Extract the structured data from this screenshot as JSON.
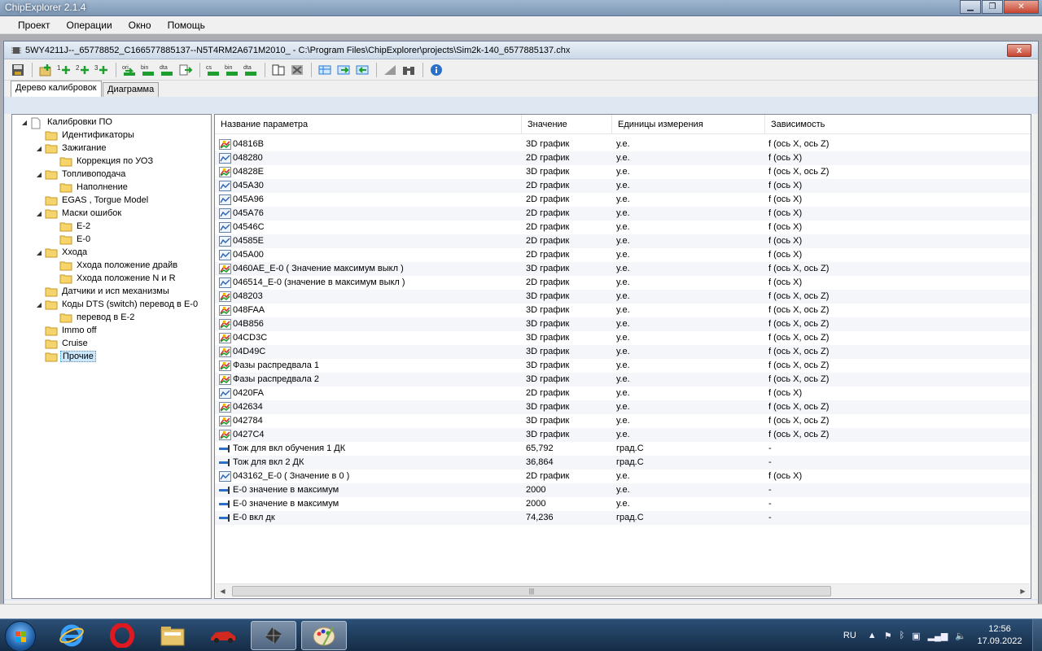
{
  "app": {
    "title": "ChipExplorer 2.1.4"
  },
  "menu": {
    "items": [
      "Проект",
      "Операции",
      "Окно",
      "Помощь"
    ]
  },
  "document": {
    "title": "5WY4211J--_65778852_C166577885137--N5T4RM2A671M2010_ - C:\\Program Files\\ChipExplorer\\projects\\Sim2k-140_6577885137.chx",
    "close_label": "x"
  },
  "toolbar": {
    "icons": [
      "save-icon",
      "add-folder-icon",
      "add-1d-icon",
      "add-2d-icon",
      "add-3d-icon",
      "import-ori-icon",
      "import-bin-icon",
      "import-dta-icon",
      "export-icon",
      "compare-1-icon",
      "compare-2-icon",
      "compare-3-icon",
      "copy-icon",
      "delete-icon",
      "table-icon",
      "table-export-icon",
      "table-import-icon",
      "triangle-icon",
      "binoculars-icon",
      "info-icon"
    ]
  },
  "tabs": [
    {
      "label": "Дерево калибровок",
      "active": true
    },
    {
      "label": "Диаграмма",
      "active": false
    }
  ],
  "tree": {
    "root": "Калибровки ПО",
    "items": [
      {
        "label": "Идентификаторы",
        "level": 1,
        "toggle": ""
      },
      {
        "label": "Зажигание",
        "level": 1,
        "toggle": "◢"
      },
      {
        "label": "Коррекция по УОЗ",
        "level": 2,
        "toggle": ""
      },
      {
        "label": "Топливоподача",
        "level": 1,
        "toggle": "◢"
      },
      {
        "label": "Наполнение",
        "level": 2,
        "toggle": ""
      },
      {
        "label": "EGAS , Torgue Model",
        "level": 1,
        "toggle": ""
      },
      {
        "label": "Маски ошибок",
        "level": 1,
        "toggle": "◢"
      },
      {
        "label": "E-2",
        "level": 2,
        "toggle": ""
      },
      {
        "label": "E-0",
        "level": 2,
        "toggle": ""
      },
      {
        "label": "Ххода",
        "level": 1,
        "toggle": "◢"
      },
      {
        "label": "Ххода положение драйв",
        "level": 2,
        "toggle": ""
      },
      {
        "label": "Ххода положение N и R",
        "level": 2,
        "toggle": ""
      },
      {
        "label": "Датчики и исп механизмы",
        "level": 1,
        "toggle": ""
      },
      {
        "label": "Коды DTS (switch) перевод в E-0",
        "level": 1,
        "toggle": "◢"
      },
      {
        "label": "перевод в E-2",
        "level": 2,
        "toggle": ""
      },
      {
        "label": "Immo off",
        "level": 1,
        "toggle": ""
      },
      {
        "label": "Cruise",
        "level": 1,
        "toggle": ""
      },
      {
        "label": "Прочие",
        "level": 1,
        "toggle": "",
        "selected": true
      }
    ]
  },
  "grid": {
    "columns": [
      "Название параметра",
      "Значение",
      "Единицы измерения",
      "Зависимость"
    ],
    "rows": [
      {
        "icon": "3d",
        "name": "04816B",
        "value": "3D график",
        "unit": "у.е.",
        "dep": "f (ось X, ось Z)"
      },
      {
        "icon": "2d",
        "name": "048280",
        "value": "2D график",
        "unit": "у.е.",
        "dep": "f (ось X)"
      },
      {
        "icon": "3d",
        "name": "04828E",
        "value": "3D график",
        "unit": "у.е.",
        "dep": "f (ось X, ось Z)"
      },
      {
        "icon": "2d",
        "name": "045A30",
        "value": "2D график",
        "unit": "у.е.",
        "dep": "f (ось X)"
      },
      {
        "icon": "2d",
        "name": "045A96",
        "value": "2D график",
        "unit": "у.е.",
        "dep": "f (ось X)"
      },
      {
        "icon": "2d",
        "name": "045A76",
        "value": "2D график",
        "unit": "у.е.",
        "dep": "f (ось X)"
      },
      {
        "icon": "2d",
        "name": "04546C",
        "value": "2D график",
        "unit": "у.е.",
        "dep": "f (ось X)"
      },
      {
        "icon": "2d",
        "name": "04585E",
        "value": "2D график",
        "unit": "у.е.",
        "dep": "f (ось X)"
      },
      {
        "icon": "2d",
        "name": "045A00",
        "value": "2D график",
        "unit": "у.е.",
        "dep": "f (ось X)"
      },
      {
        "icon": "3d",
        "name": "0460AE_E-0 ( Значение максимум выкл )",
        "value": "3D график",
        "unit": "у.е.",
        "dep": "f (ось X, ось Z)"
      },
      {
        "icon": "2d",
        "name": "046514_E-0 (значение в максимум выкл )",
        "value": "2D график",
        "unit": "у.е.",
        "dep": "f (ось X)"
      },
      {
        "icon": "3d",
        "name": "048203",
        "value": "3D график",
        "unit": "у.е.",
        "dep": "f (ось X, ось Z)"
      },
      {
        "icon": "3d",
        "name": "048FAA",
        "value": "3D график",
        "unit": "у.е.",
        "dep": "f (ось X, ось Z)"
      },
      {
        "icon": "3d",
        "name": "04B856",
        "value": "3D график",
        "unit": "у.е.",
        "dep": "f (ось X, ось Z)"
      },
      {
        "icon": "3d",
        "name": "04CD3C",
        "value": "3D график",
        "unit": "у.е.",
        "dep": "f (ось X, ось Z)"
      },
      {
        "icon": "3d",
        "name": "04D49C",
        "value": "3D график",
        "unit": "у.е.",
        "dep": "f (ось X, ось Z)"
      },
      {
        "icon": "3d",
        "name": "Фазы распредвала 1",
        "value": "3D график",
        "unit": "у.е.",
        "dep": "f (ось X, ось Z)"
      },
      {
        "icon": "3d",
        "name": "Фазы распредвала 2",
        "value": "3D график",
        "unit": "у.е.",
        "dep": "f (ось X, ось Z)"
      },
      {
        "icon": "2d",
        "name": "0420FA",
        "value": "2D график",
        "unit": "у.е.",
        "dep": "f (ось X)"
      },
      {
        "icon": "3d",
        "name": "042634",
        "value": "3D график",
        "unit": "у.е.",
        "dep": "f (ось X, ось Z)"
      },
      {
        "icon": "3d",
        "name": "042784",
        "value": "3D график",
        "unit": "у.е.",
        "dep": "f (ось X, ось Z)"
      },
      {
        "icon": "3d",
        "name": "0427C4",
        "value": "3D график",
        "unit": "у.е.",
        "dep": "f (ось X, ось Z)"
      },
      {
        "icon": "1d",
        "name": "Тож для вкл обучения 1 ДК",
        "value": "65,792",
        "unit": "град.С",
        "dep": "-"
      },
      {
        "icon": "1d",
        "name": "Тож для вкл 2 ДК",
        "value": "36,864",
        "unit": "град.С",
        "dep": "-"
      },
      {
        "icon": "2d",
        "name": "043162_E-0 ( Значение в 0 )",
        "value": "2D график",
        "unit": "у.е.",
        "dep": "f (ось X)"
      },
      {
        "icon": "1d",
        "name": "E-0 значение в максимум",
        "value": "2000",
        "unit": "у.е.",
        "dep": "-"
      },
      {
        "icon": "1d",
        "name": "E-0 значение в максимум",
        "value": "2000",
        "unit": "у.е.",
        "dep": "-"
      },
      {
        "icon": "1d",
        "name": "E-0 вкл дк",
        "value": "74,236",
        "unit": "град.С",
        "dep": "-"
      }
    ]
  },
  "taskbar": {
    "apps": [
      "internet-explorer-icon",
      "opera-icon",
      "file-explorer-icon",
      "car-app-icon",
      "chip-app-icon",
      "paint-icon"
    ],
    "active_app": "chip-app-icon",
    "language": "RU",
    "time": "12:56",
    "date": "17.09.2022"
  }
}
